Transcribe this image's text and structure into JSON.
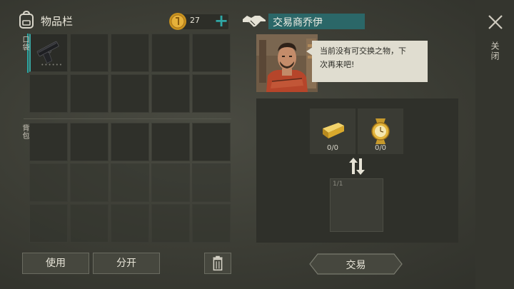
{
  "inventory": {
    "title": "物品栏",
    "coins": "27",
    "add_label": "+",
    "pocket_label": "口袋",
    "backpack_label": "背包",
    "pocket_item_icon": "pistol-icon",
    "pocket_item_dots": "••••••"
  },
  "actions": {
    "use_label": "使用",
    "split_label": "分开"
  },
  "trader": {
    "name": "交易商乔伊",
    "message_line1": "当前没有可交换之物，下",
    "message_line2": "次再来吧!",
    "offer_items": [
      {
        "icon": "gold-bar-icon",
        "count": "0/0"
      },
      {
        "icon": "gold-watch-icon",
        "count": "0/0"
      }
    ],
    "result_count": "1/1",
    "trade_label": "交易"
  },
  "close": {
    "label": "关闭"
  },
  "colors": {
    "accent": "#2aa5a2",
    "name_bar": "#2b6768"
  }
}
